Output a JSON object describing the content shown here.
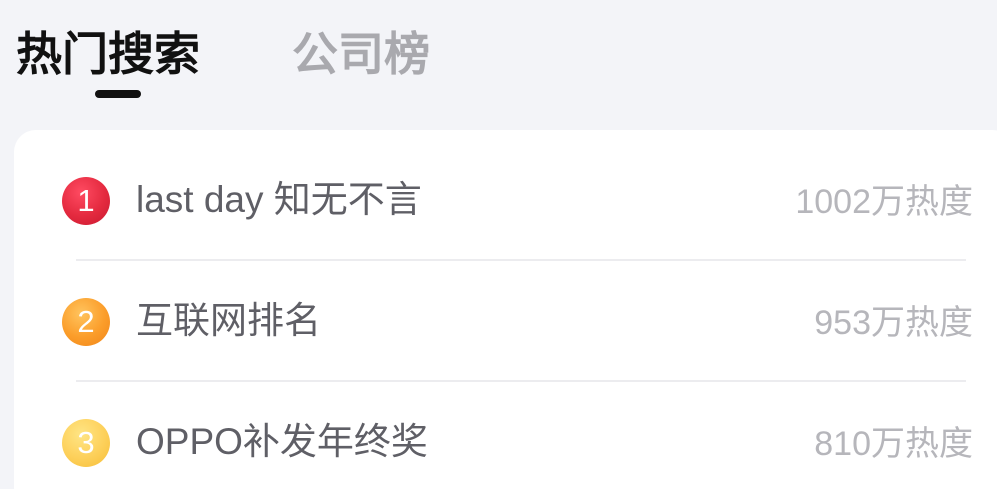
{
  "tabs": [
    {
      "label": "热门搜索",
      "active": true
    },
    {
      "label": "公司榜",
      "active": false
    }
  ],
  "hot_list": [
    {
      "rank": "1",
      "title": "last day 知无不言",
      "heat": "1002万热度"
    },
    {
      "rank": "2",
      "title": "互联网排名",
      "heat": "953万热度"
    },
    {
      "rank": "3",
      "title": "OPPO补发年终奖",
      "heat": "810万热度"
    }
  ],
  "colors": {
    "page_background": "#f3f4f8",
    "card_background": "#ffffff",
    "active_tab": "#111111",
    "inactive_tab": "#a9a9ae",
    "title_text": "#5f5f66",
    "heat_text": "#b6b6bb",
    "rank_1": "#e42a3f",
    "rank_2": "#fb9d2a",
    "rank_3": "#fdd05a"
  }
}
